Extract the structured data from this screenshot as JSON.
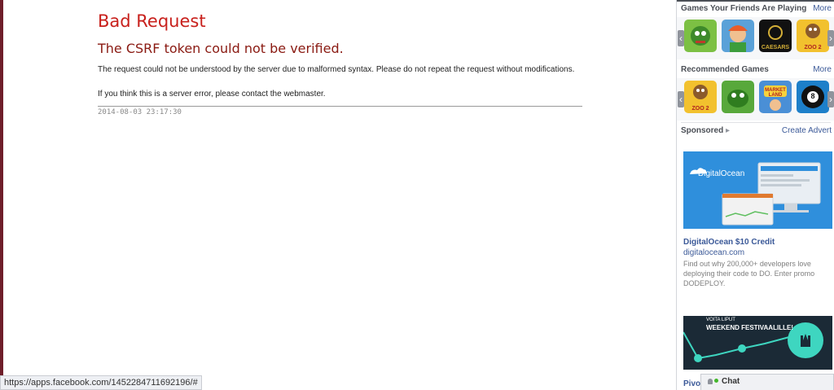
{
  "error": {
    "title": "Bad Request",
    "subtitle": "The CSRF token could not be verified.",
    "message": "The request could not be understood by the server due to malformed syntax. Please do not repeat the request without modifications.",
    "contact": "If you think this is a server error, please contact the webmaster.",
    "timestamp": "2014-08-03 23:17:30"
  },
  "status_bar": {
    "url": "https://apps.facebook.com/1452284711692196/#"
  },
  "sidebar": {
    "friends_games": {
      "title": "Games Your Friends Are Playing",
      "more_label": "More",
      "tiles": [
        {
          "name": "game-tile-1",
          "color": "#7cc043"
        },
        {
          "name": "game-tile-2",
          "color": "#5aa1d8"
        },
        {
          "name": "game-tile-caesars",
          "color": "#111111",
          "label": "CAESARS"
        },
        {
          "name": "game-tile-zoo-world",
          "color": "#f2c12e",
          "label": "ZOO 2"
        }
      ]
    },
    "recommended_games": {
      "title": "Recommended Games",
      "more_label": "More",
      "tiles": [
        {
          "name": "game-tile-zoo-world",
          "color": "#f2c12e",
          "label": "ZOO 2"
        },
        {
          "name": "game-tile-dragon",
          "color": "#58a83b"
        },
        {
          "name": "game-tile-market-land",
          "color": "#4a8fd6",
          "label": "MARKET LAND"
        },
        {
          "name": "game-tile-pool",
          "color": "#1d7fc9",
          "label": "8"
        }
      ]
    },
    "sponsored": {
      "title": "Sponsored",
      "create_label": "Create Advert",
      "ad1": {
        "brand": "DigitalOcean",
        "title": "DigitalOcean $10 Credit",
        "domain": "digitalocean.com",
        "description": "Find out why 200,000+ developers love deploying their code to DO. Enter promo DODEPLOY."
      },
      "ad2": {
        "top_text": "VOITA LIPUT",
        "headline": "WEEKEND FESTIVAALILLE!",
        "caption": "Pivo"
      }
    }
  },
  "chat": {
    "label": "Chat"
  },
  "colors": {
    "accent": "#3b5998",
    "error": "#c8201c"
  }
}
